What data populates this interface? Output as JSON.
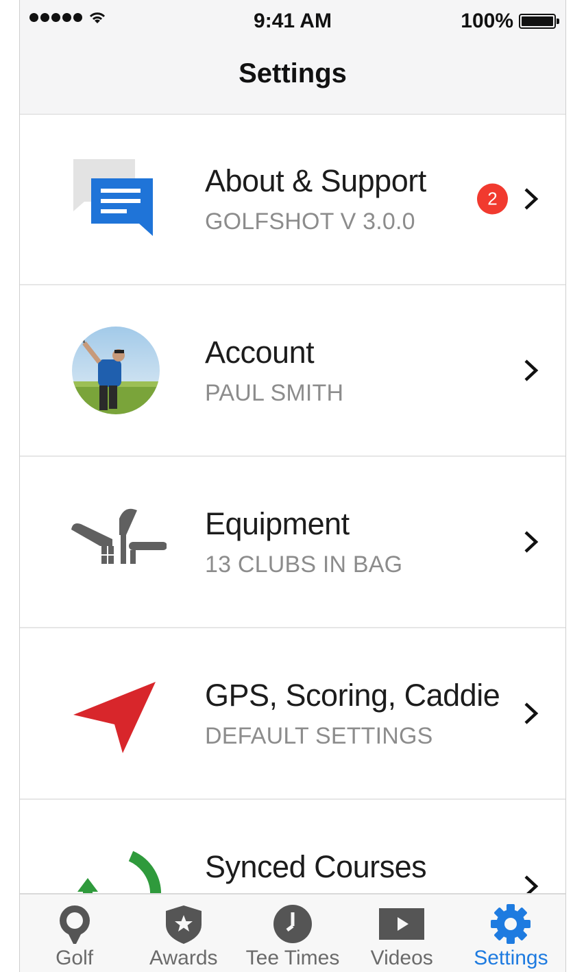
{
  "status_bar": {
    "time": "9:41 AM",
    "battery_text": "100%"
  },
  "nav": {
    "title": "Settings"
  },
  "rows": [
    {
      "title": "About & Support",
      "subtitle": "GOLFSHOT V 3.0.0",
      "badge": "2",
      "icon": "chat-bubbles-icon"
    },
    {
      "title": "Account",
      "subtitle": "PAUL SMITH",
      "icon": "avatar-photo"
    },
    {
      "title": "Equipment",
      "subtitle": "13 CLUBS IN BAG",
      "icon": "golf-clubs-icon"
    },
    {
      "title": "GPS, Scoring, Caddie",
      "subtitle": "DEFAULT SETTINGS",
      "icon": "location-arrow-icon"
    },
    {
      "title": "Synced Courses",
      "subtitle": "",
      "icon": "sync-icon"
    }
  ],
  "tabs": [
    {
      "label": "Golf",
      "icon": "golf-ball-tee-icon",
      "active": false
    },
    {
      "label": "Awards",
      "icon": "shield-star-icon",
      "active": false
    },
    {
      "label": "Tee Times",
      "icon": "clock-icon",
      "active": false
    },
    {
      "label": "Videos",
      "icon": "play-icon",
      "active": false
    },
    {
      "label": "Settings",
      "icon": "gear-icon",
      "active": true
    }
  ],
  "colors": {
    "accent_blue": "#1e7be0",
    "badge_red": "#f13a2f",
    "gps_red": "#d8262b",
    "sync_green": "#2f9a3c",
    "icon_gray": "#555555"
  }
}
